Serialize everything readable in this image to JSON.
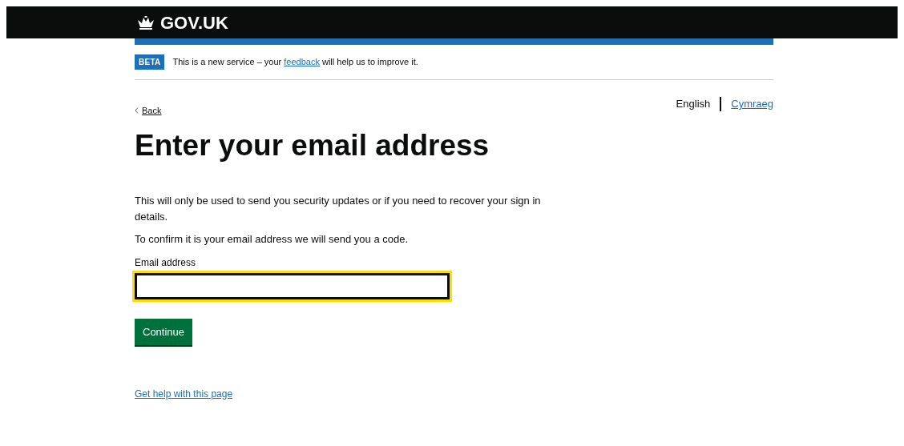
{
  "header": {
    "logo_text": "GOV.UK"
  },
  "phase_banner": {
    "tag": "BETA",
    "text_before": "This is a new service – your ",
    "link": "feedback",
    "text_after": " will help us to improve it."
  },
  "back_link": "Back",
  "languages": [
    {
      "label": "English",
      "selected": true
    },
    {
      "label": "Cymraeg",
      "selected": false
    }
  ],
  "heading": "Enter your email address",
  "paragraphs": [
    "This will only be used to send you security updates or if you need to recover your sign in details.",
    "To confirm it is your email address we will send you a code."
  ],
  "email_field": {
    "label": "Email address",
    "focused": true
  },
  "continue_button": "Continue",
  "help_link": "Get help with this page"
}
